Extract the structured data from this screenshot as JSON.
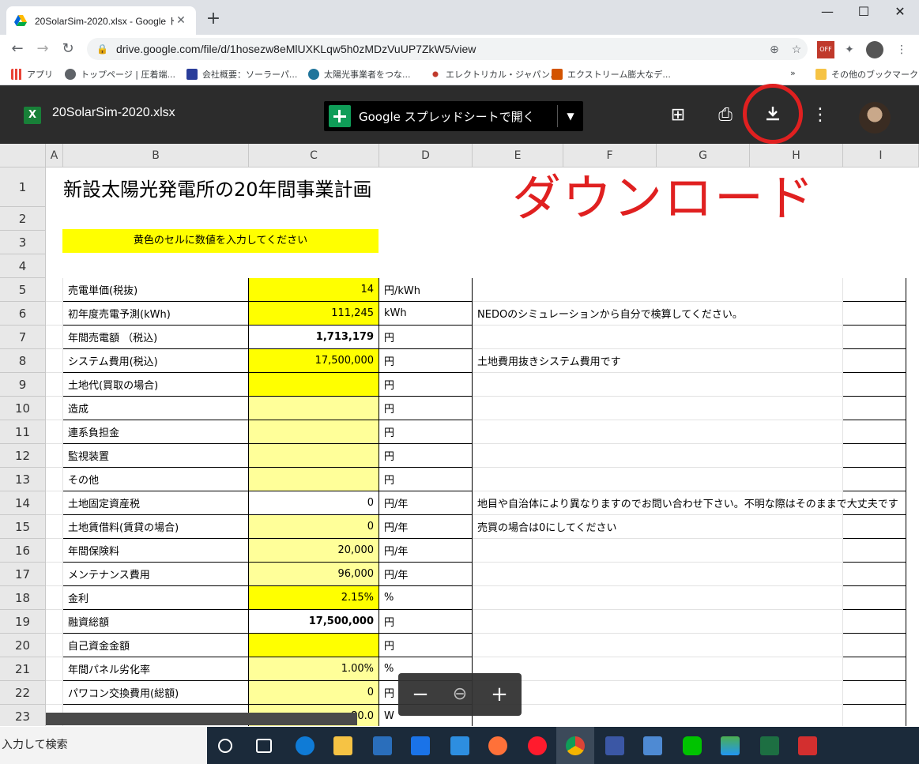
{
  "browser": {
    "tab_title": "20SolarSim-2020.xlsx - Google ド",
    "tab_close": "✕",
    "new_tab": "+",
    "url": "drive.google.com/file/d/1hosezw8eMlUXKLqw5h0zMDzVuUP7ZkW5/view",
    "window_controls": [
      "—",
      "☐",
      "✕"
    ]
  },
  "bookmarks": [
    {
      "label": "アプリ",
      "icon": "apps-grid-icon",
      "color": "#e94235"
    },
    {
      "label": "トップページ | 圧着端...",
      "icon": "globe-icon",
      "color": "#5f6368"
    },
    {
      "label": "会社概要：ソーラーパ...",
      "icon": "solar-panel-icon",
      "color": "#2a3d9a"
    },
    {
      "label": "太陽光事業者をつな...",
      "icon": "wordpress-icon",
      "color": "#21759b"
    },
    {
      "label": "エレクトリカル・ジャパン...",
      "icon": "dots-icon",
      "color": "#c0392b"
    },
    {
      "label": "エクストリーム膨大なデ...",
      "icon": "figure-icon",
      "color": "#d35400"
    }
  ],
  "bookmarks_overflow": "»",
  "other_bookmarks": "その他のブックマーク",
  "viewer": {
    "file_badge": "X",
    "filename": "20SolarSim-2020.xlsx",
    "open_with": "Google スプレッドシートで開く",
    "annotation": "ダウンロード"
  },
  "sheet": {
    "columns": [
      "A",
      "B",
      "C",
      "D",
      "E",
      "F",
      "G",
      "H",
      "I"
    ],
    "title": "新設太陽光発電所の20年間事業計画",
    "banner": "黄色のセルに数値を入力してください",
    "rows": [
      {
        "n": "5",
        "label": "売電単価(税抜)",
        "value": "14",
        "unit": "円/kWh",
        "note": "",
        "fill": "yel",
        "bold": false
      },
      {
        "n": "6",
        "label": "初年度売電予測(kWh)",
        "value": "111,245",
        "unit": "kWh",
        "note": "NEDOのシミュレーションから自分で検算してください。",
        "fill": "yel",
        "bold": false
      },
      {
        "n": "7",
        "label": "年間売電額 （税込)",
        "value": "1,713,179",
        "unit": "円",
        "note": "",
        "fill": "",
        "bold": true
      },
      {
        "n": "8",
        "label": "システム費用(税込)",
        "value": "17,500,000",
        "unit": "円",
        "note": "土地費用抜きシステム費用です",
        "fill": "yel",
        "bold": false
      },
      {
        "n": "9",
        "label": "土地代(買取の場合)",
        "value": "",
        "unit": "円",
        "note": "",
        "fill": "yel",
        "bold": false
      },
      {
        "n": "10",
        "label": "造成",
        "value": "",
        "unit": "円",
        "note": "",
        "fill": "lyel",
        "bold": false
      },
      {
        "n": "11",
        "label": "連系負担金",
        "value": "",
        "unit": "円",
        "note": "",
        "fill": "lyel",
        "bold": false
      },
      {
        "n": "12",
        "label": "監視装置",
        "value": "",
        "unit": "円",
        "note": "",
        "fill": "lyel",
        "bold": false
      },
      {
        "n": "13",
        "label": "その他",
        "value": "",
        "unit": "円",
        "note": "",
        "fill": "lyel",
        "bold": false
      },
      {
        "n": "14",
        "label": "土地固定資産税",
        "value": "0",
        "unit": "円/年",
        "note": "地目や自治体により異なりますのでお問い合わせ下さい。不明な際はそのままで大丈夫です",
        "fill": "",
        "bold": false
      },
      {
        "n": "15",
        "label": "土地賃借料(賃貸の場合)",
        "value": "0",
        "unit": "円/年",
        "note": "売買の場合は0にしてください",
        "fill": "lyel",
        "bold": false
      },
      {
        "n": "16",
        "label": "年間保険料",
        "value": "20,000",
        "unit": "円/年",
        "note": "",
        "fill": "lyel",
        "bold": false
      },
      {
        "n": "17",
        "label": "メンテナンス費用",
        "value": "96,000",
        "unit": "円/年",
        "note": "",
        "fill": "lyel",
        "bold": false
      },
      {
        "n": "18",
        "label": "金利",
        "value": "2.15%",
        "unit": "%",
        "note": "",
        "fill": "yel",
        "bold": false
      },
      {
        "n": "19",
        "label": "融資総額",
        "value": "17,500,000",
        "unit": "円",
        "note": "",
        "fill": "",
        "bold": true
      },
      {
        "n": "20",
        "label": "自己資金金額",
        "value": "",
        "unit": "円",
        "note": "",
        "fill": "yel",
        "bold": false
      },
      {
        "n": "21",
        "label": "年間パネル劣化率",
        "value": "1.00%",
        "unit": "%",
        "note": "",
        "fill": "lyel",
        "bold": false
      },
      {
        "n": "22",
        "label": "パワコン交換費用(総額)",
        "value": "0",
        "unit": "円",
        "note": "",
        "fill": "lyel",
        "bold": false
      },
      {
        "n": "23",
        "label": "",
        "value": "80.0",
        "unit": "W",
        "note": "",
        "fill": "lyel",
        "bold": false
      }
    ]
  },
  "zoom": {
    "minus": "−",
    "reset": "⊖",
    "plus": "+"
  },
  "taskbar": {
    "search": "入力して検索"
  }
}
